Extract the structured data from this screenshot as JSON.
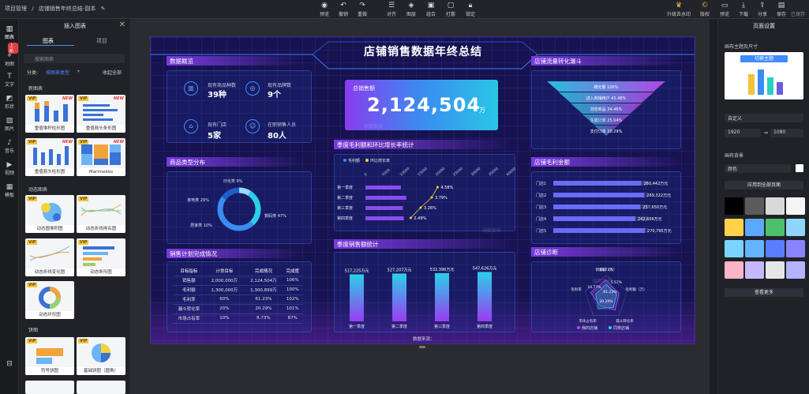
{
  "breadcrumb": {
    "root": "项目管理",
    "sep": "/",
    "doc": "店铺销售年终总结-副本"
  },
  "toolbar": [
    {
      "label": "预览",
      "icon": "eye-icon"
    },
    {
      "label": "撤销",
      "icon": "undo-icon"
    },
    {
      "label": "重做",
      "icon": "redo-icon"
    },
    {
      "label": "对齐",
      "icon": "align-icon"
    },
    {
      "label": "图层",
      "icon": "layers-icon"
    },
    {
      "label": "组合",
      "icon": "group-icon"
    },
    {
      "label": "打散",
      "icon": "ungroup-icon"
    },
    {
      "label": "锁定",
      "icon": "lock-icon"
    }
  ],
  "toolbar_right": [
    {
      "label": "升级去水印"
    },
    {
      "label": "版权"
    },
    {
      "label": "预览"
    },
    {
      "label": "下载"
    },
    {
      "label": "分享"
    },
    {
      "label": "保存"
    },
    {
      "label": "已保存"
    }
  ],
  "rail": [
    {
      "label": "图表"
    },
    {
      "label": "地图"
    },
    {
      "label": "文字"
    },
    {
      "label": "形状"
    },
    {
      "label": "图片"
    },
    {
      "label": "音乐"
    },
    {
      "label": "视频"
    },
    {
      "label": "模板"
    }
  ],
  "rail_badge": "上新",
  "left_panel": {
    "title": "插入图表",
    "close": "✕",
    "tabs": [
      "图表",
      "项目"
    ],
    "search_placeholder": "搜索图表",
    "filter_label": "分类:",
    "filter_value": "按图表类型",
    "collapse": "收起全部",
    "sections": [
      "新图表",
      "动态图表",
      "饼图"
    ],
    "thumbs": [
      {
        "cap": "重值堆积柱形图",
        "vip": "VIP",
        "new": "NEW"
      },
      {
        "cap": "重值箭头条形图",
        "vip": "VIP",
        "new": "NEW"
      },
      {
        "cap": "重值箭头柱形图",
        "vip": "VIP",
        "new": "NEW"
      },
      {
        "cap": "Marimekko",
        "vip": "VIP",
        "new": "NEW"
      },
      {
        "cap": "动态圆堆积图",
        "vip": "VIP",
        "new": ""
      },
      {
        "cap": "动态折线排名图",
        "vip": "VIP",
        "new": ""
      },
      {
        "cap": "动态折线变化图",
        "vip": "VIP",
        "new": ""
      },
      {
        "cap": "动态条形图",
        "vip": "VIP",
        "new": ""
      },
      {
        "cap": "动态环形图",
        "vip": "VIP",
        "new": ""
      },
      {
        "cap": "符号饼图",
        "vip": "VIP",
        "new": ""
      },
      {
        "cap": "基础饼图（圆角）",
        "vip": "VIP",
        "new": ""
      }
    ]
  },
  "dashboard": {
    "title": "店铺销售数据年终总结",
    "sections": {
      "overview": "数据概览",
      "funnel": "店铺流量转化漏斗",
      "category": "商品类型分布",
      "quarter_growth": "季度毛利额和环比增长率统计",
      "profit": "店铺毛利金额",
      "plan": "销售计划完成情况",
      "quarter_sales": "季度销售额统计",
      "diagnosis": "店铺诊断"
    },
    "kpis": [
      {
        "label": "现有商品种数",
        "value": "39种",
        "icon": "bar-chart-icon"
      },
      {
        "label": "现有品牌数",
        "value": "9个",
        "icon": "tag-icon"
      },
      {
        "label": "现有门店",
        "value": "5家",
        "icon": "store-icon"
      },
      {
        "label": "在职销售人员",
        "value": "80人",
        "icon": "people-icon"
      }
    ],
    "total": {
      "label": "总销售额",
      "value": "2,124,504",
      "unit": "万"
    },
    "watermark": "镝数图表",
    "table": {
      "headers": [
        "目标指标",
        "计划目标",
        "完成情况",
        "完成度"
      ],
      "rows": [
        [
          "销售额",
          "2,000,000万",
          "2,124,504万",
          "106%"
        ],
        [
          "毛利额",
          "1,300,000万",
          "1,300,899万",
          "100%"
        ],
        [
          "毛利率",
          "60%",
          "61.23%",
          "102%"
        ],
        [
          "漏斗转化率",
          "20%",
          "20.29%",
          "101%"
        ],
        [
          "市场占有率",
          "10%",
          "8.73%",
          "87%"
        ]
      ]
    },
    "footer": "数据来源：",
    "colors": {
      "purple": "#9a4cf0",
      "blue": "#3aa0ff",
      "cyan": "#2ad0e8"
    }
  },
  "chart_data": [
    {
      "type": "funnel",
      "categories": [
        "曝光量",
        "进入商铺用户",
        "浏览商品",
        "生成订单",
        "支付订单"
      ],
      "labels": [
        "曝光量 100%",
        "进入商铺用户 41.48%",
        "浏览商品 34.46%",
        "生成订单 25.04%",
        "支付订单 20.29%"
      ],
      "values": [
        100,
        41.48,
        34.46,
        25.04,
        20.29
      ]
    },
    {
      "type": "pie",
      "title": "商品类型分布",
      "categories": [
        "日化类",
        "家电类",
        "数码类",
        "居家类"
      ],
      "values": [
        9,
        29,
        47,
        15
      ],
      "labels": [
        "日化类 9%",
        "家电类 29%",
        "数码类 47%",
        "居家类 10%"
      ]
    },
    {
      "type": "bar",
      "orientation": "horizontal",
      "categories": [
        "第一季度",
        "第二季度",
        "第三季度",
        "第四季度"
      ],
      "series": [
        {
          "name": "毛利额",
          "values": [
            10000,
            11500,
            10500,
            10800
          ]
        },
        {
          "name": "环比增长率",
          "values": [
            4.58,
            3.79,
            3.26,
            2.49
          ],
          "labels": [
            "4.58%",
            "3.79%",
            "3.26%",
            "2.49%"
          ]
        }
      ],
      "x_ticks": [
        "0",
        "5000",
        "10000",
        "15000",
        "20000",
        "25000",
        "30000",
        "35000",
        "40000"
      ]
    },
    {
      "type": "bar",
      "orientation": "horizontal",
      "categories": [
        "门店1",
        "门店2",
        "门店3",
        "门店4",
        "门店5"
      ],
      "values": [
        260442,
        269322,
        257650,
        242606,
        270795
      ],
      "labels": [
        "260,442万元",
        "269,322万元",
        "257,650万元",
        "242,606万元",
        "270,795万元"
      ]
    },
    {
      "type": "bar",
      "categories": [
        "第一季度",
        "第二季度",
        "第三季度",
        "第四季度"
      ],
      "values": [
        517225,
        527207,
        532396,
        547626
      ],
      "labels": [
        "517,225万元",
        "527,207万元",
        "532,396万元",
        "547,626万元"
      ]
    },
    {
      "type": "radar",
      "categories": [
        "销售额（万）",
        "毛利额（万）",
        "漏斗转化率",
        "市场占有率",
        "毛利率"
      ],
      "series": [
        {
          "name": "我的店铺"
        },
        {
          "name": "同类店铺"
        }
      ],
      "labels": [
        "销售额（万）",
        "毛利额（万）",
        "漏斗转化率",
        "市场占有率",
        "毛利率",
        "18,73%",
        "5.57%",
        "20.29%",
        "10.77%",
        "61.23%"
      ]
    }
  ],
  "right_panel": {
    "title": "页面设置",
    "size_label": "画布主题及尺寸",
    "theme_btn": "切换主题",
    "preset": "自定义",
    "width": "1920",
    "height": "1080",
    "bg_label": "画布背景",
    "bg_type": "颜色",
    "apply": "应用到全部页面",
    "more": "查看更多",
    "swatches": [
      "#000000",
      "#5b5b5b",
      "#d9d9d9",
      "#f5f5f5",
      "#ffd24a",
      "#5aa8ff",
      "#4cc06a",
      "#8fd6ff",
      "#7bd3ff",
      "#66b3ff",
      "#5a7cff",
      "#8a82ff",
      "#ffb3c6",
      "#c7b9ff",
      "#e6e6e6",
      "#b3b3ff"
    ]
  }
}
